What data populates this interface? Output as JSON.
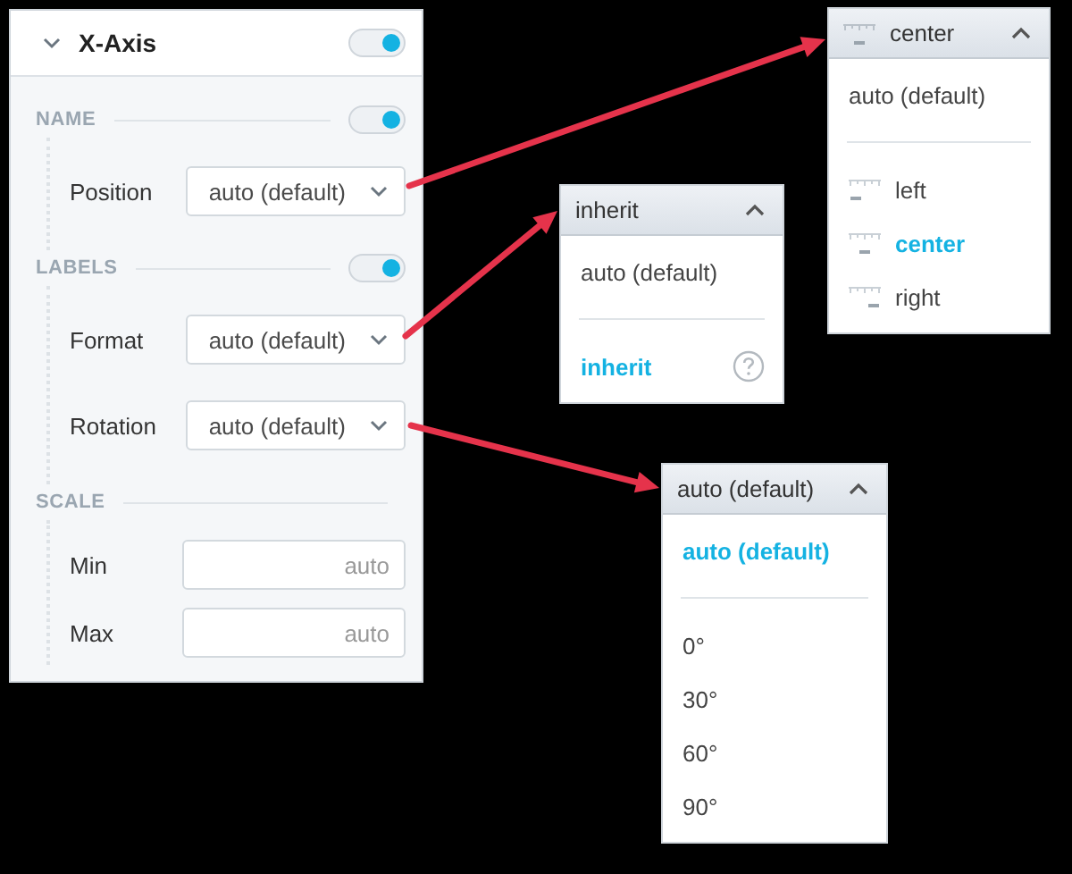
{
  "panel": {
    "title": "X-Axis",
    "toggle": {
      "on": true
    },
    "sections": [
      {
        "heading": "NAME",
        "toggle": {
          "on": true
        },
        "rows": [
          {
            "label": "Position",
            "kind": "select",
            "value": "auto (default)"
          }
        ]
      },
      {
        "heading": "LABELS",
        "toggle": {
          "on": true
        },
        "rows": [
          {
            "label": "Format",
            "kind": "select",
            "value": "auto (default)"
          },
          {
            "label": "Rotation",
            "kind": "select",
            "value": "auto (default)"
          }
        ]
      },
      {
        "heading": "SCALE",
        "rows": [
          {
            "label": "Min",
            "kind": "input",
            "placeholder": "auto"
          },
          {
            "label": "Max",
            "kind": "input",
            "placeholder": "auto"
          }
        ]
      }
    ]
  },
  "dropdowns": [
    {
      "value": "center",
      "kind": "align-center",
      "groups": [
        {
          "options": [
            {
              "label": "auto (default)",
              "selected": false
            }
          ]
        },
        {
          "options": [
            {
              "label": "left",
              "selected": false,
              "kind": "align-left"
            },
            {
              "label": "center",
              "selected": true,
              "kind": "align-center"
            },
            {
              "label": "right",
              "selected": false,
              "kind": "align-right"
            }
          ]
        }
      ]
    },
    {
      "value": "inherit",
      "groups": [
        {
          "options": [
            {
              "label": "auto (default)",
              "selected": false
            }
          ]
        },
        {
          "options": [
            {
              "label": "inherit",
              "selected": true,
              "help": true
            }
          ]
        }
      ]
    },
    {
      "value": "auto (default)",
      "groups": [
        {
          "options": [
            {
              "label": "auto (default)",
              "selected": true
            }
          ]
        },
        {
          "options": [
            {
              "label": "0°",
              "selected": false
            },
            {
              "label": "30°",
              "selected": false
            },
            {
              "label": "60°",
              "selected": false
            },
            {
              "label": "90°",
              "selected": false
            }
          ]
        }
      ]
    }
  ]
}
